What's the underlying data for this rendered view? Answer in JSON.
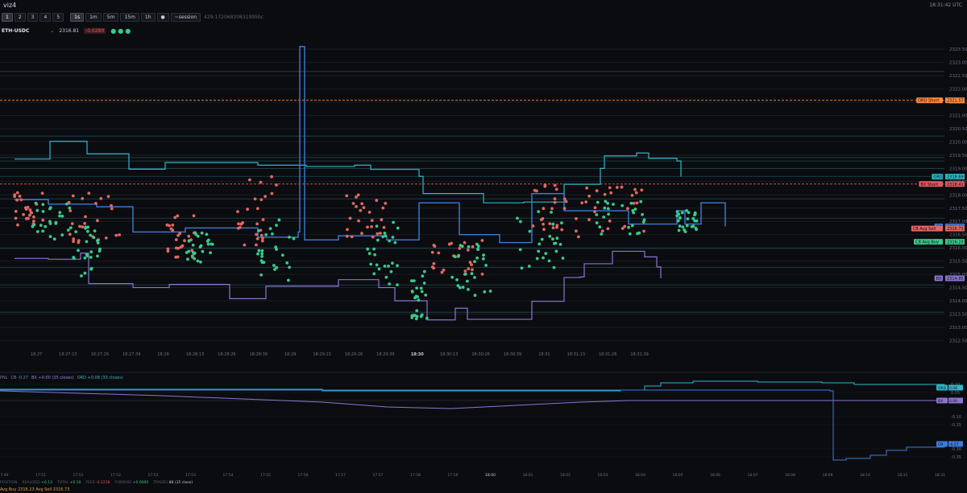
{
  "app": {
    "title": "viz4",
    "clock": "18:31:42 UTC"
  },
  "toolbar": {
    "pages": [
      "1",
      "2",
      "3",
      "4",
      "5"
    ],
    "active_page": "1",
    "intervals": [
      "1s",
      "1m",
      "5m",
      "15m",
      "1h"
    ],
    "active_interval": "1s",
    "record_label": "●",
    "session_label": "~session",
    "session_id": "429:17206830831995bc"
  },
  "symbol": {
    "name": "ETH-USDC",
    "price": "2316.81",
    "change": "-0.0280",
    "status_dots": "●●●"
  },
  "colors": {
    "cb": "#3e7bd6",
    "bx": "#8b74d0",
    "ord": "#2fb7c7",
    "buy": "#39c98a",
    "sell": "#e0685f",
    "bxshort": "#e0585f",
    "ordshort": "#ff8a3d",
    "cbavgbuy": "#39c98a",
    "cbavgsell": "#e0685f"
  },
  "main_chart": {
    "y_ticks": [
      "2323.50",
      "2323.00",
      "2322.50",
      "2322.00",
      "2321.50",
      "2321.00",
      "2320.50",
      "2320.00",
      "2319.50",
      "2319.00",
      "2318.50",
      "2318.00",
      "2317.50",
      "2317.00",
      "2316.50",
      "2316.00",
      "2315.50",
      "2315.00",
      "2314.50",
      "2314.00",
      "2313.50",
      "2313.00",
      "2312.50"
    ],
    "y_range": [
      2312.3,
      2323.9
    ],
    "x_ticks": [
      "18:27",
      "18:27:13",
      "18:27:26",
      "18:27:39",
      "18:28",
      "18:28:13",
      "18:28:26",
      "18:28:39",
      "18:29",
      "18:29:13",
      "18:29:26",
      "18:29:39",
      "18:30",
      "18:30:13",
      "18:30:26",
      "18:30:39",
      "18:31",
      "18:31:13",
      "18:31:26",
      "18:31:39"
    ],
    "price_labels": [
      {
        "label": "ORD Short",
        "value": "2321.57",
        "color": "#ff8a3d"
      },
      {
        "label": "ORD",
        "value": "2318.69",
        "color": "#2fb7c7"
      },
      {
        "label": "BX Short",
        "value": "2318.41",
        "color": "#e0585f"
      },
      {
        "label": "CB",
        "value": "2316.81",
        "color": "#3e7bd6"
      },
      {
        "label": "CB Avg Sell",
        "value": "2316.73",
        "color": "#e0685f"
      },
      {
        "label": "CB Avg Buy",
        "value": "2316.23",
        "color": "#39c98a"
      },
      {
        "label": "BX",
        "value": "2314.85",
        "color": "#8b74d0"
      }
    ]
  },
  "pnl_chart": {
    "legend": {
      "title": "PNL",
      "cb": "CB -0.27",
      "bx": "BX +0.00 (35 closes)",
      "ord": "ORD +0.08 (33 closes)"
    },
    "y_ticks": [
      "0.10",
      "0.05",
      "0.00",
      "-0.10",
      "-0.15",
      "-0.30",
      "-0.35"
    ],
    "x_ticks": [
      "17:49",
      "17:51",
      "17:52",
      "17:52",
      "17:53",
      "17:53",
      "17:54",
      "17:55",
      "17:56",
      "17:57",
      "17:57",
      "17:58",
      "17:59",
      "18:00",
      "18:01",
      "18:02",
      "18:03",
      "18:04",
      "18:05",
      "18:06",
      "18:07",
      "18:08",
      "18:09",
      "18:10",
      "18:11",
      "18:31"
    ],
    "price_labels": [
      {
        "label": "ORD",
        "value": "0.08",
        "color": "#2fb7c7"
      },
      {
        "label": "BX",
        "value": "0.00",
        "color": "#8b74d0"
      },
      {
        "label": "CB",
        "value": "-0.27",
        "color": "#3e7bd6"
      }
    ]
  },
  "stats": [
    {
      "k": "POSITION",
      "v": "",
      "cls": ""
    },
    {
      "k": "REALIZED",
      "v": "+0.13",
      "cls": "pos"
    },
    {
      "k": "TOTAL",
      "v": "+0.10",
      "cls": "pos"
    },
    {
      "k": "FEES",
      "v": "-0.2218",
      "cls": "neg"
    },
    {
      "k": "FUNDING",
      "v": "+0.0000",
      "cls": "pos"
    },
    {
      "k": "TRADES",
      "v": "88 (35 close)",
      "cls": "val"
    }
  ],
  "avg_line": "Avg Buy 2316.23 Avg Sell 2316.73"
}
